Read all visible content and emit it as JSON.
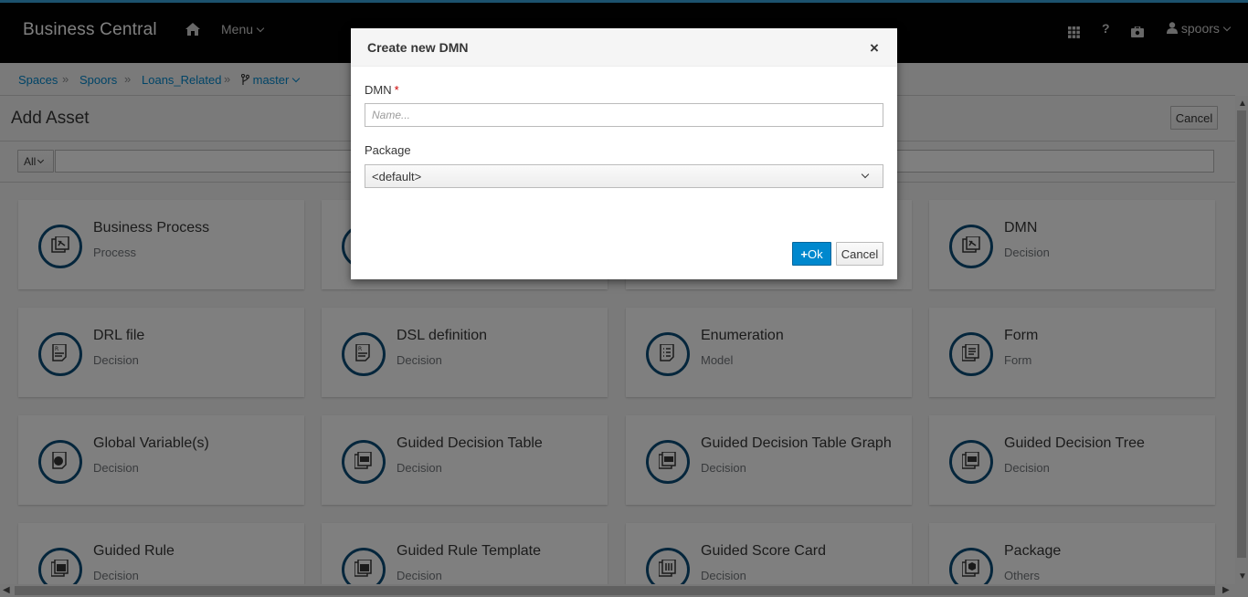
{
  "topbar": {
    "brand": "Business Central",
    "menu_label": "Menu",
    "help_label": "?",
    "user_label": "spoors",
    "accent_color": "#39a5dc"
  },
  "breadcrumb": {
    "items": [
      "Spaces",
      "Spoors",
      "Loans_Related"
    ],
    "branch": "master",
    "separator": "»"
  },
  "page": {
    "title": "Add Asset",
    "cancel_label": "Cancel",
    "filter_label": "All"
  },
  "tiles": [
    {
      "title": "Business Process",
      "subtitle": "Process",
      "icon": "process-icon"
    },
    {
      "title": "",
      "subtitle": "",
      "icon": "case-icon"
    },
    {
      "title": "",
      "subtitle": "",
      "icon": ""
    },
    {
      "title": "DMN",
      "subtitle": "Decision",
      "icon": "dmn-icon"
    },
    {
      "title": "DRL file",
      "subtitle": "Decision",
      "icon": "drl-icon"
    },
    {
      "title": "DSL definition",
      "subtitle": "Decision",
      "icon": "dsl-icon"
    },
    {
      "title": "Enumeration",
      "subtitle": "Model",
      "icon": "enumeration-icon"
    },
    {
      "title": "Form",
      "subtitle": "Form",
      "icon": "form-icon"
    },
    {
      "title": "Global Variable(s)",
      "subtitle": "Decision",
      "icon": "globe-icon"
    },
    {
      "title": "Guided Decision Table",
      "subtitle": "Decision",
      "icon": "table-icon"
    },
    {
      "title": "Guided Decision Table Graph",
      "subtitle": "Decision",
      "icon": "table-graph-icon"
    },
    {
      "title": "Guided Decision Tree",
      "subtitle": "Decision",
      "icon": "tree-icon"
    },
    {
      "title": "Guided Rule",
      "subtitle": "Decision",
      "icon": "rule-icon"
    },
    {
      "title": "Guided Rule Template",
      "subtitle": "Decision",
      "icon": "rule-template-icon"
    },
    {
      "title": "Guided Score Card",
      "subtitle": "Decision",
      "icon": "scorecard-icon"
    },
    {
      "title": "Package",
      "subtitle": "Others",
      "icon": "package-icon"
    }
  ],
  "modal": {
    "title": "Create new DMN",
    "close_label": "×",
    "dmn_label": "DMN",
    "required_mark": "*",
    "name_value": "",
    "name_placeholder": "Name...",
    "package_label": "Package",
    "package_value": "<default>",
    "ok_label": "Ok",
    "ok_icon": "+",
    "cancel_label": "Cancel",
    "primary_color": "#0088ce"
  }
}
